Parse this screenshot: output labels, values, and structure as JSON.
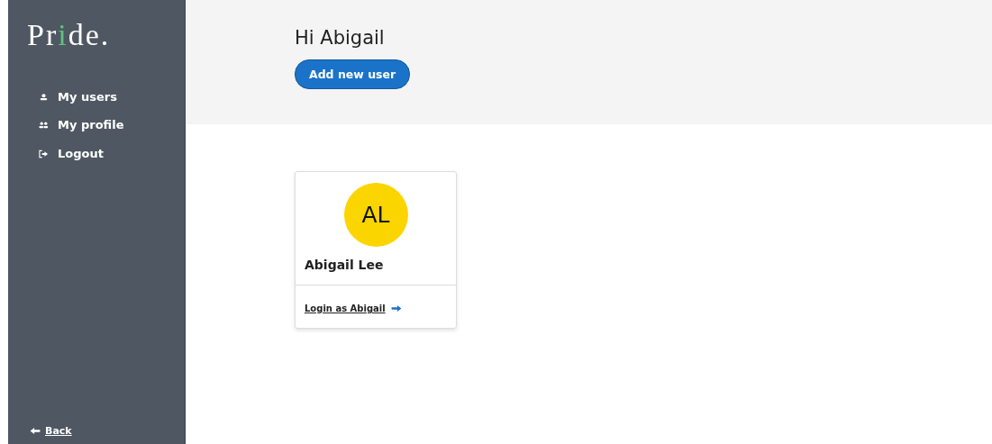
{
  "logo": [
    {
      "text": "Pr",
      "accent": false
    },
    {
      "text": "i",
      "accent": true
    },
    {
      "text": "de.",
      "accent": false
    }
  ],
  "sidebar": {
    "items": [
      {
        "label": "My users",
        "kind": "user"
      },
      {
        "label": "My profile",
        "kind": "users"
      },
      {
        "label": "Logout",
        "kind": "logout"
      }
    ],
    "back": "Back"
  },
  "header": {
    "greeting": "Hi Abigail",
    "button": "Add new user"
  },
  "users": [
    {
      "initials": "AL",
      "name": "Abigail Lee",
      "color": "#fbd500",
      "link": "Login as Abigail"
    }
  ]
}
